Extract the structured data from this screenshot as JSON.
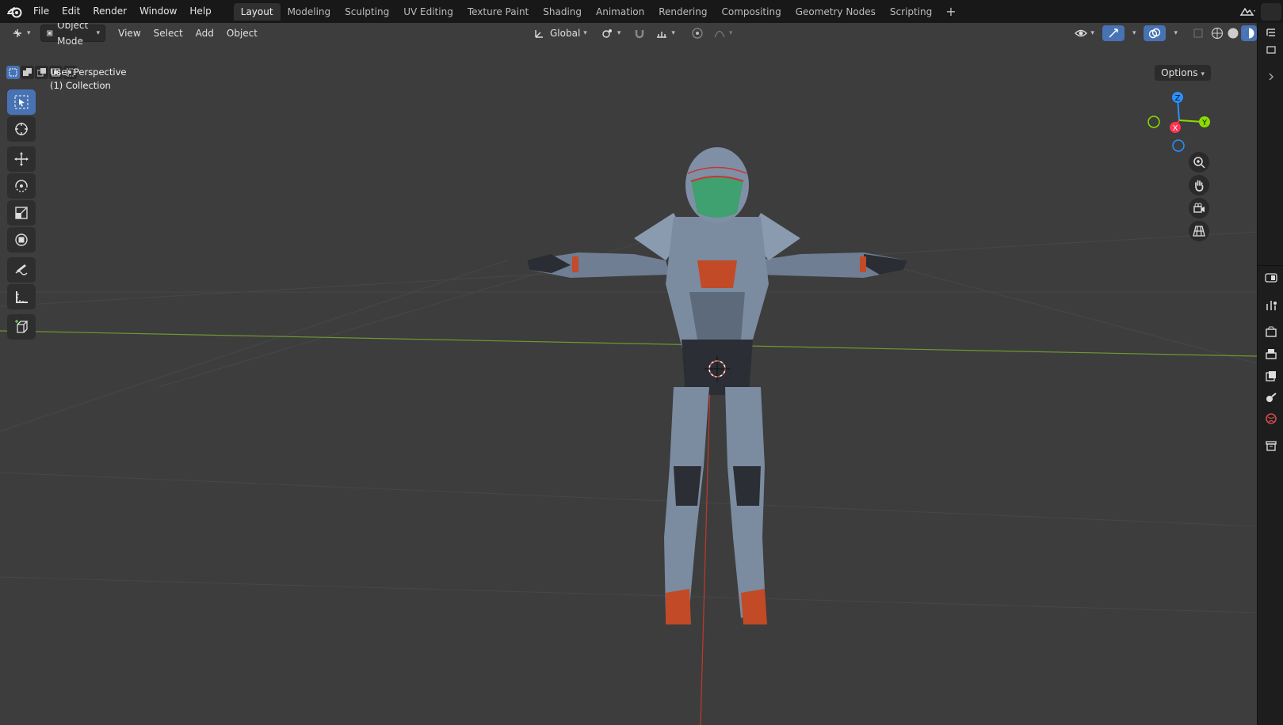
{
  "app": {
    "menus": [
      "File",
      "Edit",
      "Render",
      "Window",
      "Help"
    ],
    "workspace_tabs": [
      "Layout",
      "Modeling",
      "Sculpting",
      "UV Editing",
      "Texture Paint",
      "Shading",
      "Animation",
      "Rendering",
      "Compositing",
      "Geometry Nodes",
      "Scripting"
    ],
    "active_tab": "Layout",
    "add_tab_label": "+"
  },
  "viewport_header": {
    "mode": "Object Mode",
    "menus": [
      "View",
      "Select",
      "Add",
      "Object"
    ],
    "transform_orientation": "Global",
    "options_label": "Options"
  },
  "overlay": {
    "view_name": "User Perspective",
    "collection": "(1) Collection"
  },
  "gizmo": {
    "x_label": "X",
    "y_label": "Y",
    "z_label": "Z",
    "colors": {
      "x": "#ff3352",
      "y": "#8bdc00",
      "z": "#2890ff"
    }
  },
  "tools": [
    "select-box",
    "cursor",
    "move",
    "rotate",
    "scale",
    "transform",
    "annotate",
    "measure",
    "add-cube"
  ],
  "nav_buttons": [
    "zoom-icon",
    "hand-icon",
    "camera-icon",
    "grid-icon"
  ],
  "properties_tabs": [
    "tool",
    "render",
    "output",
    "view-layer",
    "scene",
    "world",
    "collection"
  ],
  "colors": {
    "accent": "#4772b3",
    "viewport_bg": "#3d3d3d",
    "topbar_bg": "#181818",
    "x_axis": "#c0392b",
    "y_axis": "#6e9a2e"
  }
}
